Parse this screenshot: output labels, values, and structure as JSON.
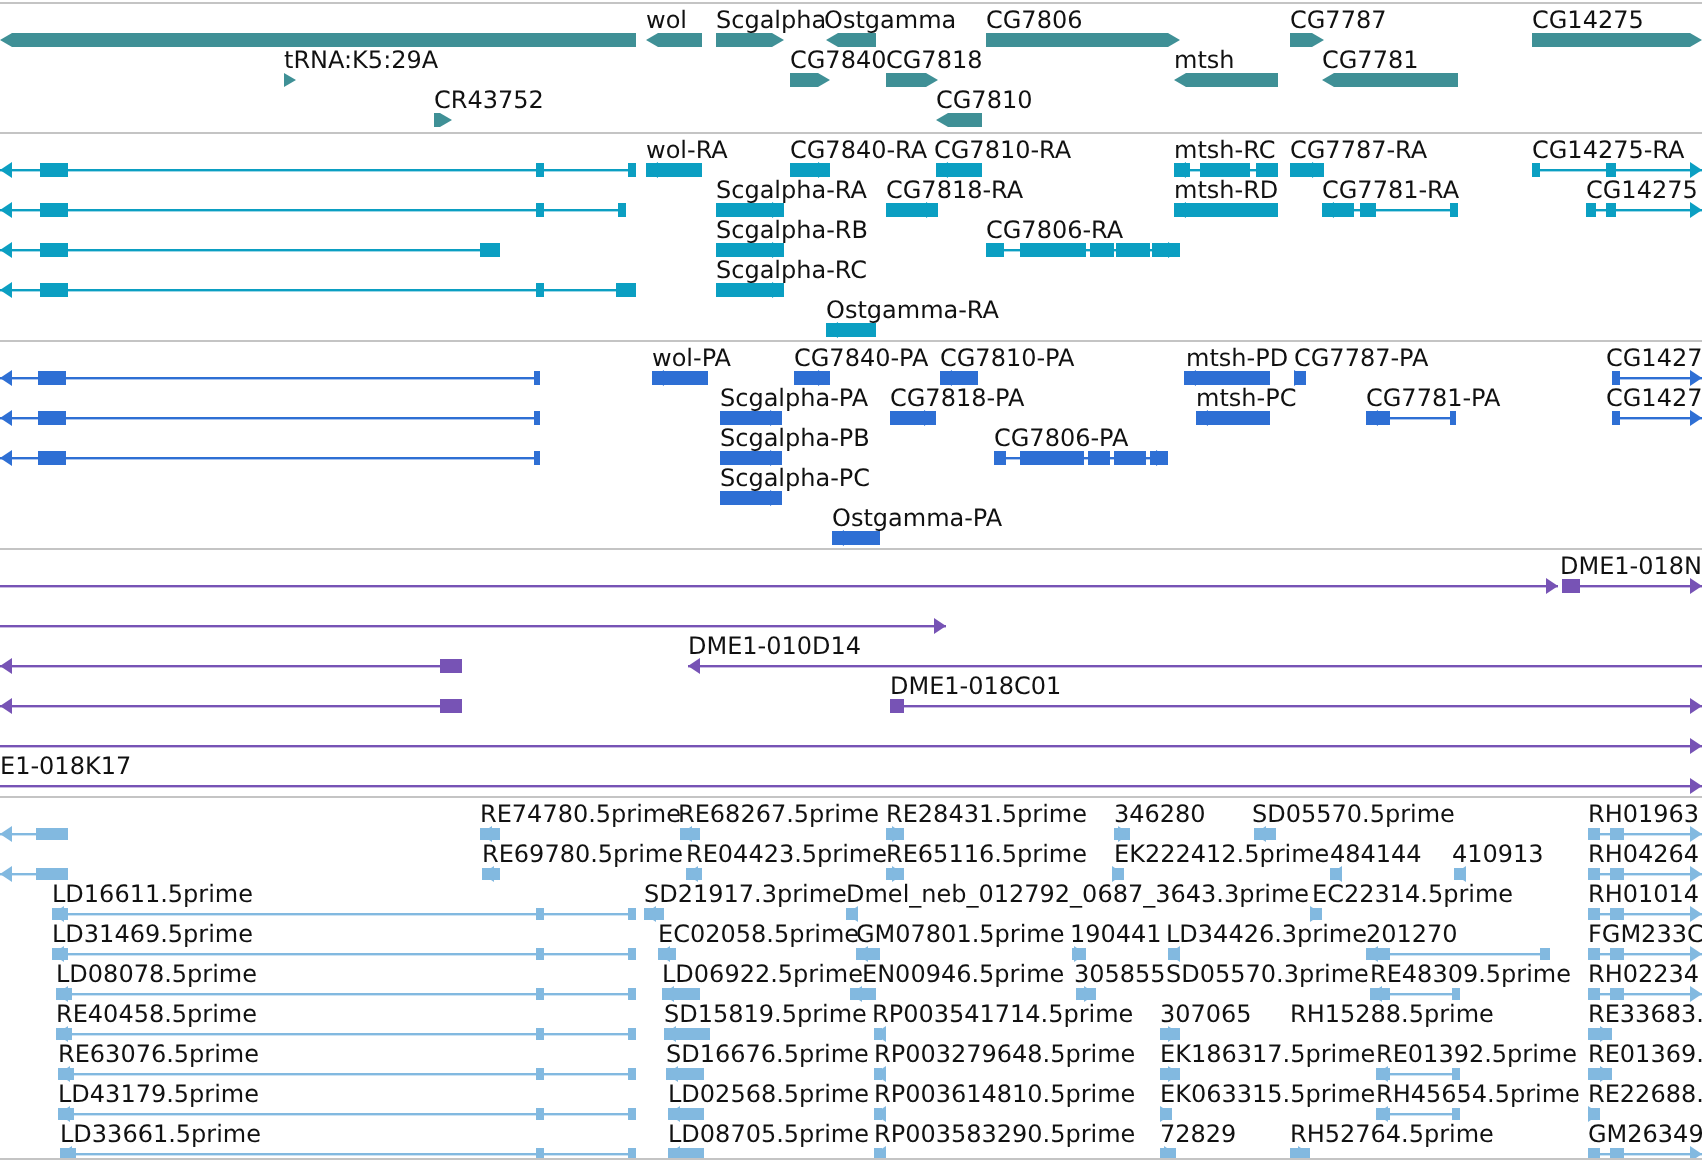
{
  "tracks": [
    {
      "kind": "gene",
      "color": "#3f9096",
      "features": [
        {
          "reverse": true
        },
        {
          "label": "wol",
          "reverse": true
        },
        {
          "label": "Scgalpha",
          "reverse": false
        },
        {
          "label": "Ostgamma",
          "reverse": true
        },
        {
          "label": "CG7806",
          "reverse": false
        },
        {
          "label": "CG7787",
          "reverse": false
        },
        {
          "label": "CG14275",
          "reverse": false
        },
        {
          "label": "tRNA:K5:29A",
          "reverse": false
        },
        {
          "label": "CG7840",
          "reverse": false
        },
        {
          "label": "CG7818",
          "reverse": false
        },
        {
          "label": "mtsh",
          "reverse": true
        },
        {
          "label": "CG7781",
          "reverse": true
        },
        {
          "label": "CR43752",
          "reverse": false
        },
        {
          "label": "CG7810",
          "reverse": true
        }
      ]
    },
    {
      "kind": "transcript",
      "color": "#0b9fc2",
      "features": [
        {
          "reverse": true
        },
        {
          "label": "wol-RA",
          "reverse": true
        },
        {
          "label": "CG7840-RA",
          "reverse": false
        },
        {
          "label": "CG7810-RA",
          "reverse": true
        },
        {
          "label": "mtsh-RC",
          "reverse": true
        },
        {
          "label": "CG7787-RA",
          "reverse": false
        },
        {
          "label": "CG14275-RA",
          "reverse": false
        },
        {
          "reverse": true
        },
        {
          "label": "Scgalpha-RA",
          "reverse": false
        },
        {
          "label": "CG7818-RA",
          "reverse": false
        },
        {
          "label": "mtsh-RD",
          "reverse": true
        },
        {
          "label": "CG7781-RA",
          "reverse": true
        },
        {
          "label": "CG14275",
          "reverse": false
        },
        {
          "reverse": true
        },
        {
          "label": "Scgalpha-RB",
          "reverse": false
        },
        {
          "label": "CG7806-RA",
          "reverse": false
        },
        {
          "reverse": true
        },
        {
          "label": "Scgalpha-RC",
          "reverse": false
        },
        {
          "label": "Ostgamma-RA",
          "reverse": true
        }
      ]
    },
    {
      "kind": "transcript",
      "color": "#2e6fd4",
      "features": [
        {
          "reverse": true
        },
        {
          "label": "wol-PA",
          "reverse": true
        },
        {
          "label": "CG7840-PA",
          "reverse": false
        },
        {
          "label": "CG7810-PA",
          "reverse": true
        },
        {
          "label": "mtsh-PD",
          "reverse": true
        },
        {
          "label": "CG7787-PA",
          "reverse": false
        },
        {
          "label": "CG1427",
          "reverse": false
        },
        {
          "reverse": true
        },
        {
          "label": "Scgalpha-PA",
          "reverse": false
        },
        {
          "label": "CG7818-PA",
          "reverse": false
        },
        {
          "label": "mtsh-PC",
          "reverse": true
        },
        {
          "label": "CG7781-PA",
          "reverse": true
        },
        {
          "label": "CG1427",
          "reverse": false
        },
        {
          "reverse": true
        },
        {
          "label": "Scgalpha-PB",
          "reverse": false
        },
        {
          "label": "CG7806-PA",
          "reverse": false
        },
        {
          "label": "Scgalpha-PC",
          "reverse": false
        },
        {
          "label": "Ostgamma-PA",
          "reverse": true
        }
      ]
    },
    {
      "kind": "clone",
      "color": "#7753b5",
      "features": [
        {
          "reverse": false
        },
        {
          "label": "DME1-018N",
          "reverse": false
        },
        {
          "reverse": false
        },
        {
          "reverse": true
        },
        {
          "label": "DME1-010D14",
          "reverse": true
        },
        {
          "reverse": true
        },
        {
          "label": "DME1-018C01",
          "reverse": false
        },
        {
          "reverse": false
        },
        {
          "label": "E1-018K17",
          "reverse": false
        }
      ]
    },
    {
      "kind": "est",
      "color": "#82b9e0",
      "features": [
        {
          "reverse": true
        },
        {
          "label": "RE74780.5prime",
          "reverse": true
        },
        {
          "label": "RE68267.5prime",
          "reverse": true
        },
        {
          "label": "RE28431.5prime",
          "reverse": false
        },
        {
          "label": "346280",
          "reverse": false
        },
        {
          "label": "SD05570.5prime",
          "reverse": true
        },
        {
          "label": "RH01963",
          "reverse": false
        },
        {
          "reverse": true
        },
        {
          "label": "RE69780.5prime",
          "reverse": true
        },
        {
          "label": "RE04423.5prime",
          "reverse": true
        },
        {
          "label": "RE65116.5prime",
          "reverse": false
        },
        {
          "label": "EK222412.5prime",
          "reverse": false
        },
        {
          "label": "484144",
          "reverse": true
        },
        {
          "label": "410913",
          "reverse": true
        },
        {
          "label": "RH04264",
          "reverse": false
        },
        {
          "label": "LD16611.5prime",
          "reverse": true
        },
        {
          "label": "SD21917.3prime",
          "reverse": true
        },
        {
          "label": "Dmel_neb_012792_0687_3643.3prime",
          "reverse": true
        },
        {
          "label": "EC22314.5prime",
          "reverse": false
        },
        {
          "label": "RH01014",
          "reverse": false
        },
        {
          "label": "LD31469.5prime",
          "reverse": true
        },
        {
          "label": "EC02058.5prime",
          "reverse": true
        },
        {
          "label": "GM07801.5prime",
          "reverse": true
        },
        {
          "label": "190441",
          "reverse": false
        },
        {
          "label": "LD34426.3prime",
          "reverse": true
        },
        {
          "label": "201270",
          "reverse": true
        },
        {
          "label": "FGM233C",
          "reverse": false
        },
        {
          "label": "LD08078.5prime",
          "reverse": true
        },
        {
          "label": "LD06922.5prime",
          "reverse": true
        },
        {
          "label": "EN00946.5prime",
          "reverse": true
        },
        {
          "label": "305855",
          "reverse": false
        },
        {
          "label": "SD05570.3prime"
        },
        {
          "label": "RE48309.5prime",
          "reverse": true
        },
        {
          "label": "RH02234",
          "reverse": false
        },
        {
          "label": "RE40458.5prime",
          "reverse": true
        },
        {
          "label": "SD15819.5prime",
          "reverse": true
        },
        {
          "label": "RP003541714.5prime",
          "reverse": true
        },
        {
          "label": "307065",
          "reverse": false
        },
        {
          "label": "RH15288.5prime"
        },
        {
          "label": "RE33683.",
          "reverse": false
        },
        {
          "label": "RE63076.5prime",
          "reverse": true
        },
        {
          "label": "SD16676.5prime",
          "reverse": true
        },
        {
          "label": "RP003279648.5prime",
          "reverse": true
        },
        {
          "label": "EK186317.5prime",
          "reverse": false
        },
        {
          "label": "RE01392.5prime",
          "reverse": true
        },
        {
          "label": "RE01369.",
          "reverse": false
        },
        {
          "label": "LD43179.5prime",
          "reverse": true
        },
        {
          "label": "LD02568.5prime",
          "reverse": true
        },
        {
          "label": "RP003614810.5prime",
          "reverse": true
        },
        {
          "label": "EK063315.5prime",
          "reverse": false
        },
        {
          "label": "RH45654.5prime",
          "reverse": true
        },
        {
          "label": "RE22688.",
          "reverse": false
        },
        {
          "label": "LD33661.5prime",
          "reverse": true
        },
        {
          "label": "LD08705.5prime",
          "reverse": true
        },
        {
          "label": "RP003583290.5prime",
          "reverse": true
        },
        {
          "label": "72829",
          "reverse": false
        },
        {
          "label": "RH52764.5prime",
          "reverse": false
        },
        {
          "label": "GM26349",
          "reverse": false
        }
      ]
    }
  ]
}
